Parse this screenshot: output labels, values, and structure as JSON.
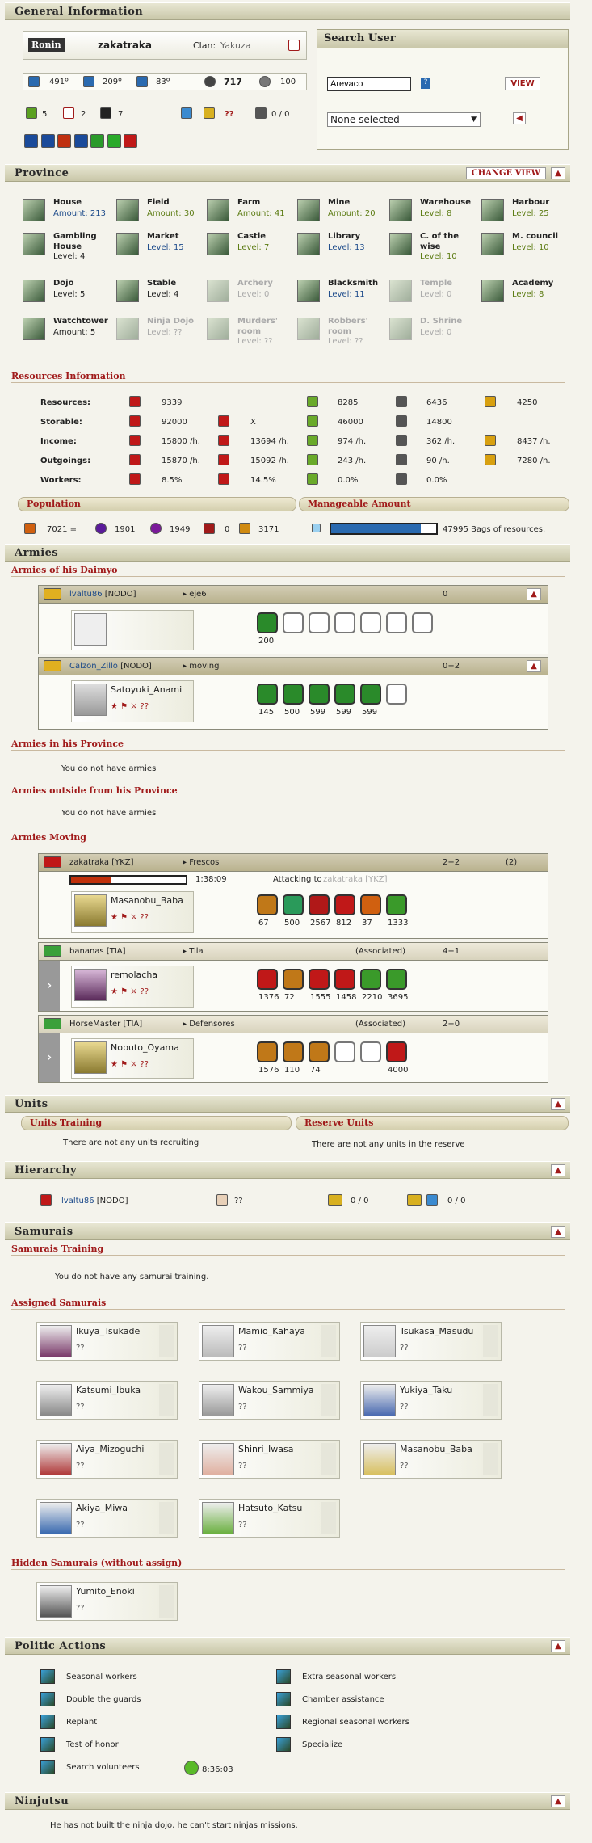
{
  "general": {
    "title": "General Information",
    "rank_badge": "Ronin",
    "user": "zakatraka",
    "clan_label": "Clan:",
    "clan": "Yakuza",
    "stat1": "491º",
    "stat2": "209º",
    "stat3": "83º",
    "honor": "717",
    "stat5": "100",
    "c1": "5",
    "c2": "2",
    "c3": "7",
    "qq": "??",
    "ratio": "0 / 0"
  },
  "search": {
    "title": "Search User",
    "value": "Arevaco",
    "help": "?",
    "view_button": "VIEW",
    "select": "None selected"
  },
  "province": {
    "title": "Province",
    "change_view": "CHANGE VIEW",
    "buildings": [
      {
        "name": "House",
        "info": "Amount: 213",
        "state": "blue"
      },
      {
        "name": "Field",
        "info": "Amount: 30",
        "state": "green"
      },
      {
        "name": "Farm",
        "info": "Amount: 41",
        "state": "green"
      },
      {
        "name": "Mine",
        "info": "Amount: 20",
        "state": "green"
      },
      {
        "name": "Warehouse",
        "info": "Level: 8",
        "state": "green"
      },
      {
        "name": "Harbour",
        "info": "Level: 25",
        "state": "green"
      },
      {
        "name": "Gambling House",
        "info": "Level: 4",
        "state": "normal"
      },
      {
        "name": "Market",
        "info": "Level: 15",
        "state": "blue"
      },
      {
        "name": "Castle",
        "info": "Level: 7",
        "state": "green"
      },
      {
        "name": "Library",
        "info": "Level: 13",
        "state": "blue"
      },
      {
        "name": "C. of the wise",
        "info": "Level: 10",
        "state": "green"
      },
      {
        "name": "M. council",
        "info": "Level: 10",
        "state": "green"
      },
      {
        "name": "Dojo",
        "info": "Level: 5",
        "state": "normal"
      },
      {
        "name": "Stable",
        "info": "Level: 4",
        "state": "normal"
      },
      {
        "name": "Archery",
        "info": "Level: 0",
        "state": "grey"
      },
      {
        "name": "Blacksmith",
        "info": "Level: 11",
        "state": "blue"
      },
      {
        "name": "Temple",
        "info": "Level: 0",
        "state": "grey"
      },
      {
        "name": "Academy",
        "info": "Level: 8",
        "state": "green"
      },
      {
        "name": "Watchtower",
        "info": "Amount: 5",
        "state": "normal"
      },
      {
        "name": "Ninja Dojo",
        "info": "Level: ??",
        "state": "grey"
      },
      {
        "name": "Murders' room",
        "info": "Level: ??",
        "state": "grey"
      },
      {
        "name": "Robbers' room",
        "info": "Level: ??",
        "state": "grey"
      },
      {
        "name": "D. Shrine",
        "info": "Level: 0",
        "state": "grey"
      }
    ]
  },
  "resources": {
    "title": "Resources Information",
    "rows": [
      {
        "label": "Resources:",
        "v": [
          "9339",
          "",
          "8285",
          "6436",
          "4250"
        ]
      },
      {
        "label": "Storable:",
        "v": [
          "92000",
          "X",
          "46000",
          "14800",
          ""
        ]
      },
      {
        "label": "Income:",
        "v": [
          "15800 /h.",
          "13694 /h.",
          "974 /h.",
          "362 /h.",
          "8437 /h."
        ]
      },
      {
        "label": "Outgoings:",
        "v": [
          "15870 /h.",
          "15092 /h.",
          "243 /h.",
          "90 /h.",
          "7280 /h."
        ]
      },
      {
        "label": "Workers:",
        "v": [
          "8.5%",
          "14.5%",
          "0.0%",
          "0.0%",
          ""
        ]
      }
    ]
  },
  "population": {
    "title": "Population",
    "total": "7021 =",
    "p1": "1901",
    "p2": "1949",
    "p3": "0",
    "p4": "3171"
  },
  "manageable": {
    "title": "Manageable Amount",
    "fill": 0.85,
    "text": "47995 Bags of resources."
  },
  "armies": {
    "title": "Armies",
    "daimyo_title": "Armies of his Daimyo",
    "a1": {
      "user": "lvaltu86",
      "tag": "[NODO]",
      "dest": "eje6",
      "count": "0",
      "units": [
        "200",
        "",
        "",
        "",
        "",
        "",
        ""
      ]
    },
    "a2": {
      "user": "Calzon_Zillo",
      "tag": "[NODO]",
      "dest": "moving",
      "count": "0+2",
      "samurai": "Satoyuki_Anami",
      "units": [
        "145",
        "500",
        "599",
        "599",
        "599",
        ""
      ]
    },
    "in_province_title": "Armies in his Province",
    "no_armies": "You do not have armies",
    "outside_title": "Armies outside from his Province",
    "no_armies2": "You do not have armies",
    "moving_title": "Armies Moving",
    "m1": {
      "user": "zakatraka",
      "tag": "[YKZ]",
      "dest": "Frescos",
      "count": "2+2",
      "extra": "(2)",
      "time": "1:38:09",
      "progress": 0.35,
      "attack": "Attacking to",
      "target": "zakatraka [YKZ]",
      "samurai": "Masanobu_Baba",
      "units": [
        "67",
        "500",
        "2567",
        "812",
        "37",
        "1333"
      ]
    },
    "m2": {
      "user": "bananas",
      "tag": "[TIA]",
      "dest": "Tila",
      "assoc": "(Associated)",
      "count": "4+1",
      "samurai": "remolacha",
      "units": [
        "1376",
        "72",
        "1555",
        "1458",
        "2210",
        "3695"
      ]
    },
    "m3": {
      "user": "HorseMaster",
      "tag": "[TIA]",
      "dest": "Defensores",
      "assoc": "(Associated)",
      "count": "2+0",
      "samurai": "Nobuto_Oyama",
      "units": [
        "1576",
        "110",
        "74",
        "",
        "",
        "4000"
      ]
    }
  },
  "units": {
    "title": "Units",
    "training_title": "Units Training",
    "reserve_title": "Reserve Units",
    "training_text": "There are not any units recruiting",
    "reserve_text": "There are not any units in the reserve"
  },
  "hierarchy": {
    "title": "Hierarchy",
    "user": "lvaltu86",
    "tag": "[NODO]",
    "q": "??",
    "r1": "0 / 0",
    "r2": "0 / 0"
  },
  "samurais": {
    "title": "Samurais",
    "training_title": "Samurais Training",
    "training_text": "You do not have any samurai training.",
    "assigned_title": "Assigned Samurais",
    "list": [
      "Ikuya_Tsukade",
      "Mamio_Kahaya",
      "Tsukasa_Masudu",
      "Katsumi_Ibuka",
      "Wakou_Sammiya",
      "Yukiya_Taku",
      "Aiya_Mizoguchi",
      "Shinri_Iwasa",
      "Masanobu_Baba",
      "Akiya_Miwa",
      "Hatsuto_Katsu"
    ],
    "stat": "??",
    "hidden_title": "Hidden Samurais (without assign)",
    "hidden": [
      "Yumito_Enoki"
    ]
  },
  "politic": {
    "title": "Politic Actions",
    "left": [
      "Seasonal workers",
      "Double the guards",
      "Replant",
      "Test of honor",
      "Search volunteers"
    ],
    "right": [
      "Extra seasonal workers",
      "Chamber assistance",
      "Regional seasonal workers",
      "Specialize"
    ],
    "timer": "8:36:03"
  },
  "ninjutsu": {
    "title": "Ninjutsu",
    "text": "He has not built the ninja dojo, he can't start ninjas missions."
  }
}
